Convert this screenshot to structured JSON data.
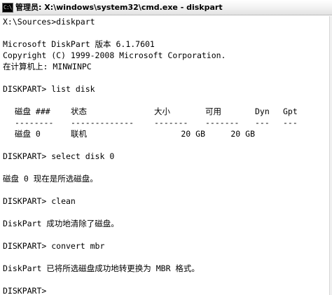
{
  "window": {
    "title": "管理员: X:\\windows\\system32\\cmd.exe - diskpart",
    "icon": "cmd-console-icon",
    "icon_glyph": "C:\\"
  },
  "console": {
    "lines": [
      "X:\\Sources>diskpart",
      "Microsoft DiskPart 版本 6.1.7601",
      "Copyright (C) 1999-2008 Microsoft Corporation.",
      "在计算机上: MINWINPC",
      "DISKPART> list disk",
      "DISKPART> select disk 0",
      "磁盘 0 现在是所选磁盘。",
      "DISKPART> clean",
      "DiskPart 成功地清除了磁盘。",
      "DISKPART> convert mbr",
      "DiskPart 已将所选磁盘成功地转更换为 MBR 格式。",
      "DISKPART>"
    ],
    "disk_table": {
      "headers": {
        "disk": "磁盘 ###",
        "status": "状态",
        "size": "大小",
        "free": "可用",
        "dyn": "Dyn",
        "gpt": "Gpt"
      },
      "separators": {
        "disk": "--------",
        "status": "-------------",
        "size": "-------",
        "free": "-------",
        "dyn": "---",
        "gpt": "---"
      },
      "rows": [
        {
          "disk": "磁盘 0",
          "status": "联机",
          "size": "20 GB",
          "free": "20 GB",
          "dyn": "",
          "gpt": ""
        }
      ]
    }
  }
}
